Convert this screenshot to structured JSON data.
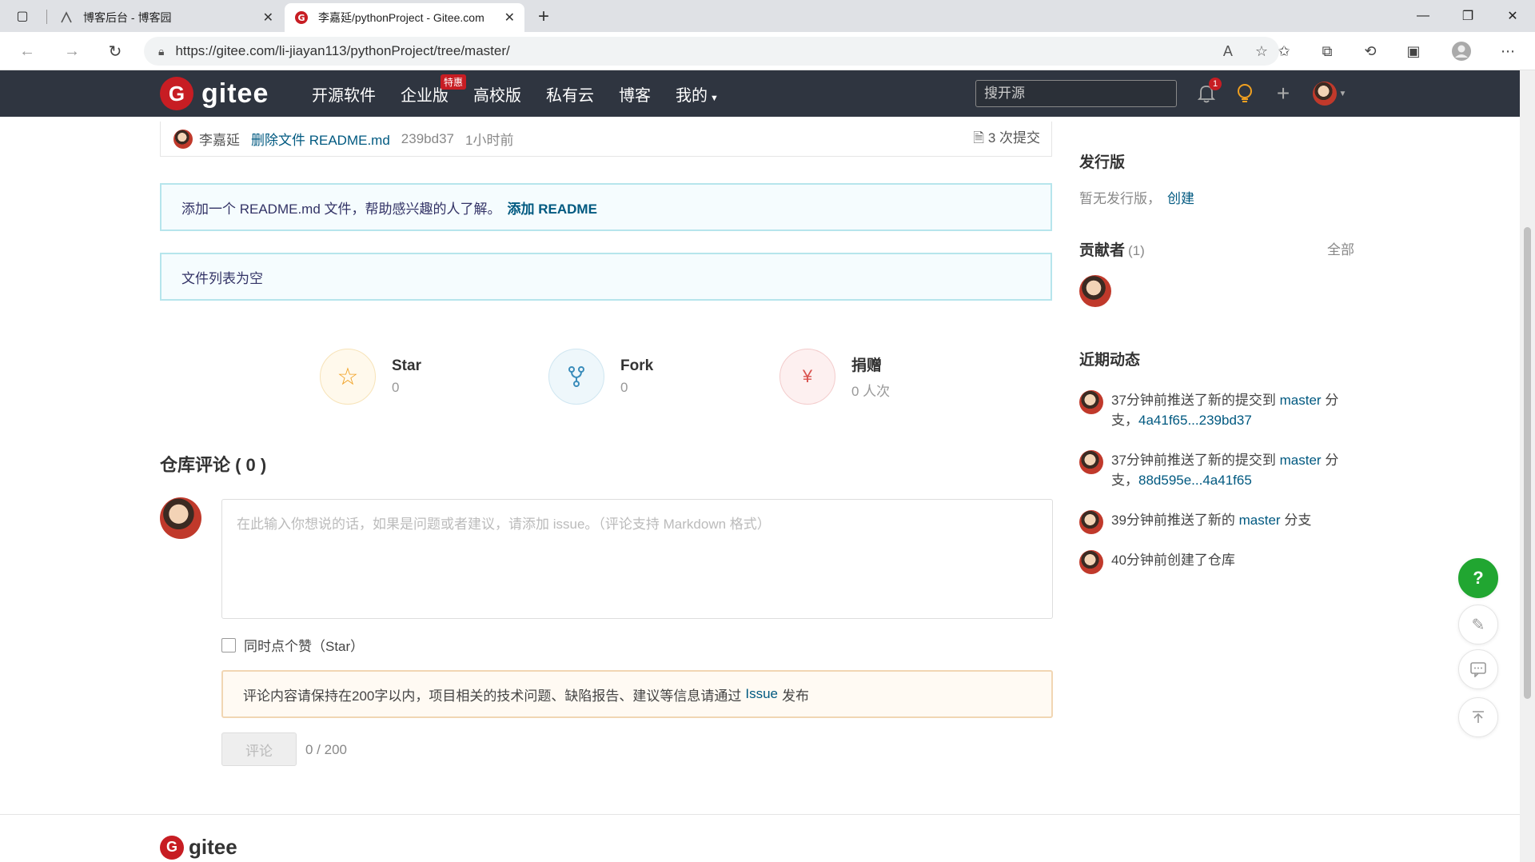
{
  "browser": {
    "tabs": [
      {
        "title": "博客后台 - 博客园",
        "active": false
      },
      {
        "title": "李嘉延/pythonProject - Gitee.com",
        "active": true
      }
    ],
    "url": "https://gitee.com/li-jiayan113/pythonProject/tree/master/"
  },
  "header": {
    "logo_text": "gitee",
    "nav": [
      "开源软件",
      "企业版",
      "高校版",
      "私有云",
      "博客",
      "我的"
    ],
    "hot_badge": "特惠",
    "search_placeholder": "搜开源",
    "notification_count": "1"
  },
  "commit": {
    "author": "李嘉延",
    "message": "删除文件 README.md",
    "sha": "239bd37",
    "time": "1小时前",
    "count": "3 次提交"
  },
  "readme_notice": {
    "text": "添加一个 README.md 文件，帮助感兴趣的人了解。",
    "link": "添加 README"
  },
  "empty_notice": "文件列表为空",
  "stats": [
    {
      "label": "Star",
      "value": "0"
    },
    {
      "label": "Fork",
      "value": "0"
    },
    {
      "label": "捐赠",
      "value": "0 人次"
    }
  ],
  "comments": {
    "title": "仓库评论 ( 0 )",
    "placeholder": "在此输入你想说的话，如果是问题或者建议，请添加 issue。（评论支持 Markdown 格式）",
    "star_checkbox": "同时点个赞（Star）",
    "warning_prefix": "评论内容请保持在200字以内，项目相关的技术问题、缺陷报告、建议等信息请通过",
    "warning_link": "Issue",
    "warning_suffix": "发布",
    "submit": "评论",
    "counter": "0 / 200"
  },
  "sidebar": {
    "releases_title": "发行版",
    "releases_text": "暂无发行版，",
    "releases_link": "创建",
    "contributors_title": "贡献者",
    "contributors_count": "(1)",
    "contributors_all": "全部",
    "activity_title": "近期动态",
    "activity": [
      {
        "pre": "37分钟前推送了新的提交到 ",
        "branch": "master",
        "mid": " 分支，",
        "range": "4a41f65...239bd37"
      },
      {
        "pre": "37分钟前推送了新的提交到 ",
        "branch": "master",
        "mid": " 分支，",
        "range": "88d595e...4a41f65"
      },
      {
        "pre": "39分钟前推送了新的 ",
        "branch": "master",
        "mid": " 分支",
        "range": ""
      },
      {
        "pre": "40分钟前创建了仓库",
        "branch": "",
        "mid": "",
        "range": ""
      }
    ]
  },
  "footer": {
    "logo_text": "gitee"
  },
  "fab": {
    "help": "?"
  }
}
